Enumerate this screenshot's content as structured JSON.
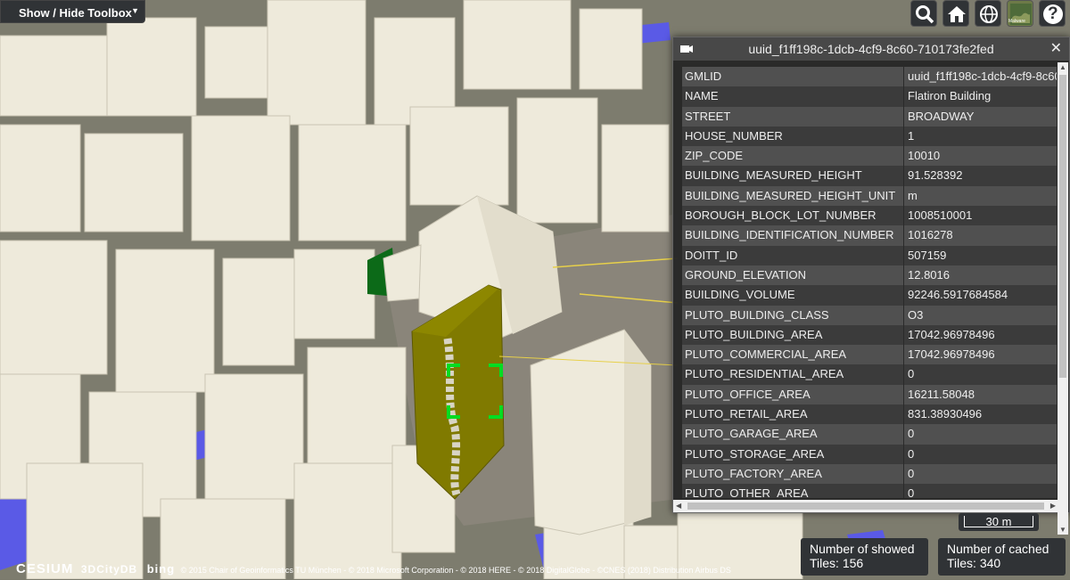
{
  "toolbox": {
    "label": "Show / Hide Toolbox",
    "caret": "▼"
  },
  "toolbar": {
    "icons": [
      "search-icon",
      "home-icon",
      "globe-icon",
      "basemap-icon",
      "help-icon"
    ],
    "basemap_caption": "Malware",
    "help_glyph": "?"
  },
  "panel": {
    "title": "uuid_f1ff198c-1dcb-4cf9-8c60-710173fe2fed",
    "close_glyph": "✕",
    "attributes": [
      {
        "key": "GMLID",
        "value": "uuid_f1ff198c-1dcb-4cf9-8c60"
      },
      {
        "key": "NAME",
        "value": "Flatiron Building"
      },
      {
        "key": "STREET",
        "value": "BROADWAY"
      },
      {
        "key": "HOUSE_NUMBER",
        "value": "1"
      },
      {
        "key": "ZIP_CODE",
        "value": "10010"
      },
      {
        "key": "BUILDING_MEASURED_HEIGHT",
        "value": "91.528392"
      },
      {
        "key": "BUILDING_MEASURED_HEIGHT_UNIT",
        "value": "m"
      },
      {
        "key": "BOROUGH_BLOCK_LOT_NUMBER",
        "value": "1008510001"
      },
      {
        "key": "BUILDING_IDENTIFICATION_NUMBER",
        "value": "1016278"
      },
      {
        "key": "DOITT_ID",
        "value": "507159"
      },
      {
        "key": "GROUND_ELEVATION",
        "value": "12.8016"
      },
      {
        "key": "BUILDING_VOLUME",
        "value": "92246.5917684584"
      },
      {
        "key": "PLUTO_BUILDING_CLASS",
        "value": "O3"
      },
      {
        "key": "PLUTO_BUILDING_AREA",
        "value": "17042.96978496"
      },
      {
        "key": "PLUTO_COMMERCIAL_AREA",
        "value": "17042.96978496"
      },
      {
        "key": "PLUTO_RESIDENTIAL_AREA",
        "value": "0"
      },
      {
        "key": "PLUTO_OFFICE_AREA",
        "value": "16211.58048"
      },
      {
        "key": "PLUTO_RETAIL_AREA",
        "value": "831.38930496"
      },
      {
        "key": "PLUTO_GARAGE_AREA",
        "value": "0"
      },
      {
        "key": "PLUTO_STORAGE_AREA",
        "value": "0"
      },
      {
        "key": "PLUTO_FACTORY_AREA",
        "value": "0"
      },
      {
        "key": "PLUTO_OTHER_AREA",
        "value": "0"
      }
    ]
  },
  "scale": {
    "label": "30 m"
  },
  "tiles": {
    "showed_label_1": "Number of showed",
    "showed_label_2": "Tiles: 156",
    "cached_label_1": "Number of cached",
    "cached_label_2": "Tiles: 340"
  },
  "credits": {
    "cesium": "CESIUM",
    "citydb": "3DCityDB",
    "bing": "bing",
    "text": "© 2015 Chair of Geoinformatics TU München - © 2018 Microsoft Corporation - © 2018 HERE - © 2018 DigitalGlobe - ©CNES (2018) Distribution Airbus DS"
  },
  "colors": {
    "building": "#eeeadb",
    "building_shade": "#cfcbbd",
    "highlight": "#807a00",
    "water": "#5a5ae6",
    "selection": "#00dd22",
    "panel_bg": "#262626"
  }
}
